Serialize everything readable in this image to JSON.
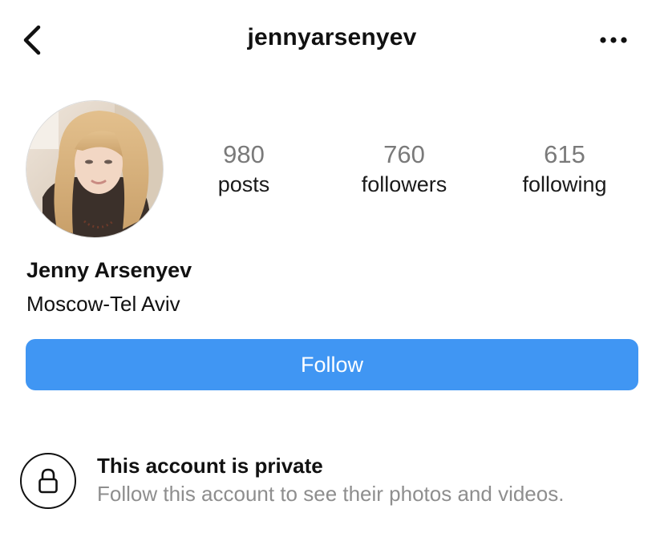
{
  "header": {
    "username": "jennyarsenyev",
    "back_icon": "chevron-left-icon",
    "more_icon": "more-horizontal-icon"
  },
  "profile": {
    "full_name": "Jenny Arsenyev",
    "bio": "Moscow-Tel Aviv",
    "stats": {
      "posts": {
        "count": "980",
        "label": "posts"
      },
      "followers": {
        "count": "760",
        "label": "followers"
      },
      "following": {
        "count": "615",
        "label": "following"
      }
    }
  },
  "actions": {
    "follow_label": "Follow",
    "follow_color": "#4096f3"
  },
  "private_notice": {
    "icon": "lock-icon",
    "title": "This account is private",
    "subtitle": "Follow this account to see their photos and videos."
  }
}
